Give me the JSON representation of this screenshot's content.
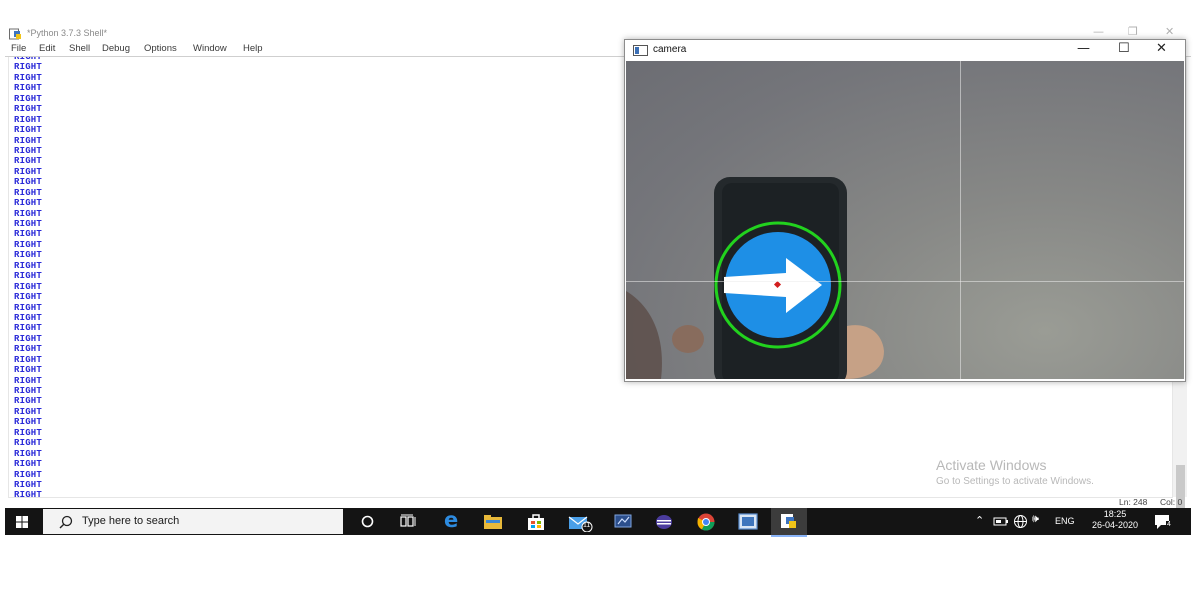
{
  "shell": {
    "title": "*Python 3.7.3 Shell*",
    "menu": [
      "File",
      "Edit",
      "Shell",
      "Debug",
      "Options",
      "Window",
      "Help"
    ],
    "output_lines": [
      "RIGHT",
      "RIGHT",
      "RIGHT",
      "RIGHT",
      "RIGHT",
      "RIGHT",
      "RIGHT",
      "RIGHT",
      "RIGHT",
      "RIGHT",
      "RIGHT",
      "RIGHT",
      "RIGHT",
      "RIGHT",
      "RIGHT",
      "RIGHT",
      "RIGHT",
      "RIGHT",
      "RIGHT",
      "RIGHT",
      "RIGHT",
      "RIGHT",
      "RIGHT",
      "RIGHT",
      "RIGHT",
      "RIGHT",
      "RIGHT",
      "RIGHT",
      "RIGHT",
      "RIGHT",
      "RIGHT",
      "RIGHT",
      "RIGHT",
      "RIGHT",
      "RIGHT",
      "RIGHT",
      "RIGHT",
      "RIGHT",
      "RIGHT",
      "RIGHT",
      "RIGHT",
      "RIGHT",
      "RIGHT",
      "RIGHT"
    ],
    "status_ln": "Ln: 248",
    "status_col": "Col: 0",
    "text_color": "#2a2ad8"
  },
  "camera": {
    "title": "camera",
    "sign_color": "#1e8fe6",
    "circle_color": "#22d21e",
    "center_marker_color": "#d21e1e"
  },
  "watermark": {
    "line1": "Activate Windows",
    "line2": "Go to Settings to activate Windows."
  },
  "taskbar": {
    "search_placeholder": "Type here to search",
    "icons": [
      "cortana-icon",
      "task-view-icon",
      "edge-icon",
      "file-explorer-icon",
      "store-icon",
      "mail-icon",
      "remote-desktop-icon",
      "eclipse-icon",
      "chrome-icon",
      "photos-icon",
      "python-idle-icon"
    ],
    "mail_badge": "11",
    "tray": {
      "language": "ENG",
      "time": "18:25",
      "date": "26-04-2020",
      "notification_count": "4"
    }
  }
}
